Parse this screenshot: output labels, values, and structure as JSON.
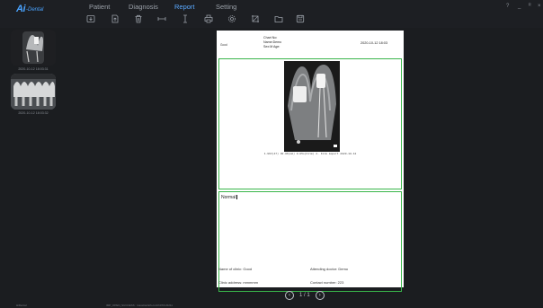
{
  "app": {
    "logo_main": "Ai",
    "logo_sub": "-Dental",
    "user": "HiDental"
  },
  "nav": {
    "patient": "Patient",
    "diagnosis": "Diagnosis",
    "report": "Report",
    "setting": "Setting"
  },
  "window_controls": {
    "help": "?",
    "minimize": "_",
    "restore": "ᴿ",
    "close": "×"
  },
  "toolbar_icons": [
    "import-icon",
    "export-icon",
    "delete-icon",
    "measure-horizontal-icon",
    "measure-vertical-icon",
    "print-icon",
    "settings-icon",
    "crop-icon",
    "folder-icon",
    "save-icon"
  ],
  "thumbnails": [
    {
      "caption": "2020-10-12 18:03:31"
    },
    {
      "caption": "2020-10-12 18:03:32"
    }
  ],
  "report": {
    "clinic_logo": "Good",
    "chart_no": "Chart No:",
    "name": "Name:Demo",
    "sex_age": "Sex:M   Age:",
    "date": "2020-10-12 18:03",
    "image_caption": "1.9KV(47)   30.0K(mA)   0.05s(Film)   2. Film import   2020-10-12",
    "notes": "Normal",
    "clinic_name": "Name of clinic: Good",
    "doctor": "Attending doctor: Demo",
    "address": "Clinic address: mmmmm",
    "contact": "Contact number: 223"
  },
  "pager": {
    "current": "1",
    "separator": "/",
    "total": "1"
  },
  "status": {
    "left": "HiDental",
    "message": "IMP_OPEN_SUCCESS : /cavebar/ath-cur/ch07F1/0211"
  }
}
